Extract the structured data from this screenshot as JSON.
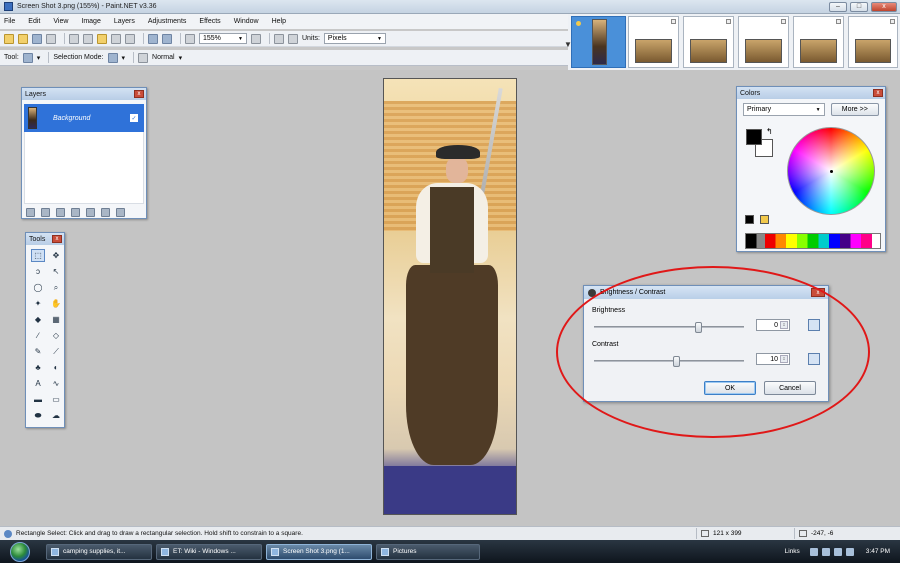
{
  "window": {
    "title": "Screen Shot 3.png (155%) - Paint.NET v3.36",
    "minimize": "–",
    "maximize": "□",
    "close": "x"
  },
  "menu": [
    "File",
    "Edit",
    "View",
    "Image",
    "Layers",
    "Adjustments",
    "Effects",
    "Window",
    "Help"
  ],
  "toolbar": {
    "zoom_value": "155%",
    "units_label": "Units:",
    "units_value": "Pixels"
  },
  "toolbar2": {
    "tool_label": "Tool:",
    "selection_mode_label": "Selection Mode:",
    "blend_mode": "Normal"
  },
  "layers_window": {
    "title": "Layers",
    "layer_name": "Background",
    "close": "x"
  },
  "tools_window": {
    "title": "Tools",
    "close": "x"
  },
  "colors_window": {
    "title": "Colors",
    "mode": "Primary",
    "more_button": "More >>",
    "close": "x"
  },
  "dialog": {
    "title": "Brightness / Contrast",
    "brightness_label": "Brightness",
    "brightness_value": "0",
    "brightness_level": 0.7,
    "contrast_label": "Contrast",
    "contrast_value": "10",
    "contrast_level": 0.55,
    "ok": "OK",
    "cancel": "Cancel",
    "close": "x"
  },
  "statusbar": {
    "message": "Rectangle Select: Click and drag to draw a rectangular selection. Hold shift to constrain to a square.",
    "image_size": "121 x 399",
    "cursor_pos": "-247, -6"
  },
  "taskbar": {
    "items": [
      "camping supplies, it...",
      "ET: Wiki - Windows ...",
      "Screen Shot 3.png (1...",
      "Pictures"
    ],
    "links": "Links",
    "clock": "3:47 PM"
  },
  "colors": {
    "accent": "#2f72d9",
    "annotation": "#e01818"
  }
}
